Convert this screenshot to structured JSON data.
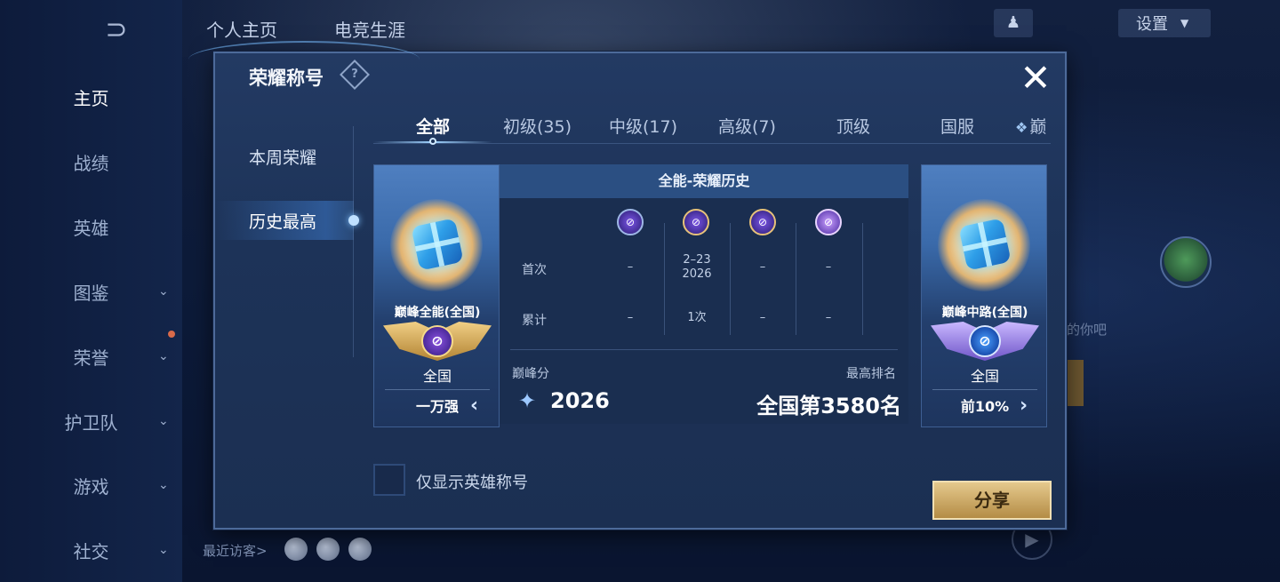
{
  "background": {
    "back_icon": "⊃",
    "top_tabs": [
      "个人主页",
      "电竞生涯"
    ],
    "settings_label": "设置",
    "nav": [
      {
        "label": "主页",
        "chevron": false,
        "active": true
      },
      {
        "label": "战绩",
        "chevron": false
      },
      {
        "label": "英雄",
        "chevron": false
      },
      {
        "label": "图鉴",
        "chevron": true
      },
      {
        "label": "荣誉",
        "chevron": true
      },
      {
        "label": "护卫队",
        "chevron": true
      },
      {
        "label": "游戏",
        "chevron": true
      },
      {
        "label": "社交",
        "chevron": true
      }
    ],
    "recent_visitors_label": "最近访客>",
    "side_text": "的你吧"
  },
  "modal": {
    "title": "荣耀称号",
    "help_icon": "?",
    "close_icon": "✕",
    "side_menu": [
      {
        "label": "本周荣耀",
        "active": false
      },
      {
        "label": "历史最高",
        "active": true
      }
    ],
    "tabs": [
      {
        "label": "全部",
        "active": true
      },
      {
        "label": "初级(35)"
      },
      {
        "label": "中级(17)"
      },
      {
        "label": "高级(7)"
      },
      {
        "label": "顶级"
      },
      {
        "label": "国服"
      },
      {
        "label": "巅"
      }
    ],
    "left_card": {
      "name": "巅峰全能(全国)",
      "region": "全国",
      "rank": "一万强"
    },
    "right_card": {
      "name": "巅峰中路(全国)",
      "region": "全国",
      "rank": "前10%"
    },
    "history": {
      "header": "全能-荣耀历史",
      "rows": [
        {
          "label": "首次",
          "cells": [
            "–",
            "2–23\n2026",
            "–",
            "–"
          ]
        },
        {
          "label": "累计",
          "cells": [
            "–",
            "1次",
            "–",
            "–"
          ]
        }
      ],
      "peak_label": "巅峰分",
      "peak_score": "2026",
      "rank_label": "最高排名",
      "rank_value": "全国第3580名"
    },
    "checkbox_label": "仅显示英雄称号",
    "share_label": "分享"
  }
}
